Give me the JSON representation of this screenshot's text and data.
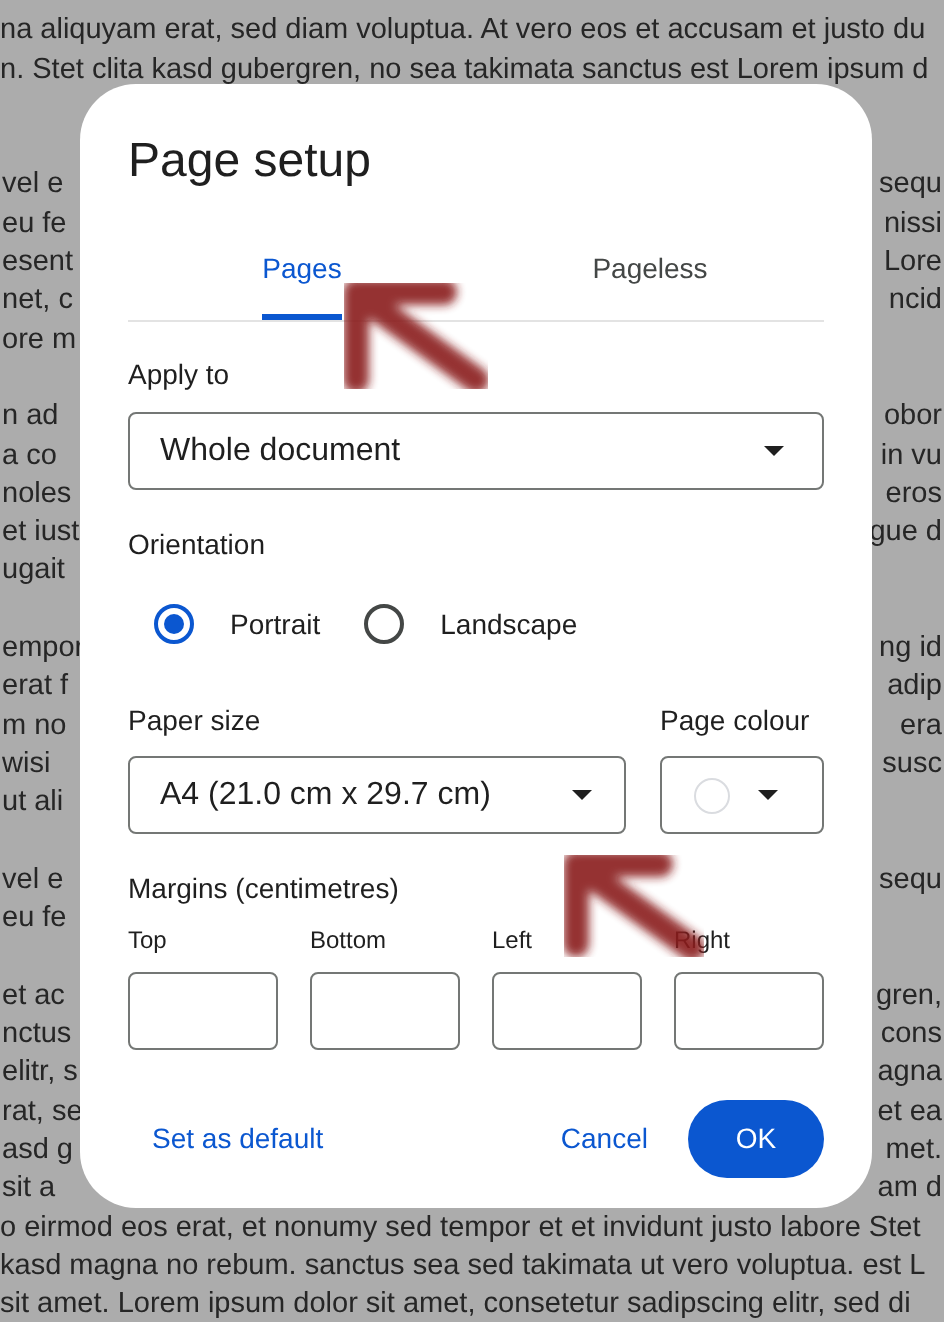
{
  "document": {
    "lines": [
      {
        "kind": "blank"
      },
      {
        "kind": "full",
        "text": "na aliquyam erat, sed diam voluptua. At vero eos et accusam et justo du"
      },
      {
        "kind": "full",
        "text": "n. Stet clita kasd gubergren, no sea takimata sanctus est Lorem ipsum d"
      },
      {
        "kind": "blank"
      },
      {
        "kind": "blank"
      },
      {
        "kind": "split",
        "left": "vel e",
        "right": "sequ"
      },
      {
        "kind": "split",
        "left": "eu fe",
        "right": "nissi"
      },
      {
        "kind": "split",
        "left": "esent",
        "right": "Lore"
      },
      {
        "kind": "split",
        "left": "net, c",
        "right": "ncid"
      },
      {
        "kind": "split",
        "left": "ore m"
      },
      {
        "kind": "blank"
      },
      {
        "kind": "split",
        "left": "n ad",
        "right": "obor"
      },
      {
        "kind": "split",
        "left": "a co",
        "right": "in vu"
      },
      {
        "kind": "split",
        "left": "noles",
        "right": "eros"
      },
      {
        "kind": "split",
        "left": "et iust",
        "right": "gue d"
      },
      {
        "kind": "split",
        "left": "ugait"
      },
      {
        "kind": "blank"
      },
      {
        "kind": "split",
        "left": "empor",
        "right": "ng id"
      },
      {
        "kind": "split",
        "left": "erat f",
        "right": "adip"
      },
      {
        "kind": "split",
        "left": "m no",
        "right": "era"
      },
      {
        "kind": "split",
        "left": "wisi",
        "right": "susc"
      },
      {
        "kind": "split",
        "left": "ut ali"
      },
      {
        "kind": "blank"
      },
      {
        "kind": "split",
        "left": "vel e",
        "right": "sequ"
      },
      {
        "kind": "split",
        "left": "eu fe"
      },
      {
        "kind": "blank"
      },
      {
        "kind": "split",
        "left": "et ac",
        "right": "gren,"
      },
      {
        "kind": "split",
        "left": "nctus",
        "right": "cons"
      },
      {
        "kind": "split",
        "left": "elitr, s",
        "right": "agna"
      },
      {
        "kind": "split",
        "left": "rat, se",
        "right": "et ea"
      },
      {
        "kind": "split",
        "left": "asd g",
        "right": "met."
      },
      {
        "kind": "split",
        "left": "sit a",
        "right": "am d"
      },
      {
        "kind": "full",
        "text": "o eirmod eos erat, et nonumy sed tempor et et invidunt justo labore Stet"
      },
      {
        "kind": "full",
        "text": "kasd magna no rebum. sanctus sea sed takimata ut vero voluptua. est L"
      },
      {
        "kind": "full",
        "text": "sit amet. Lorem ipsum dolor sit amet, consetetur sadipscing elitr, sed di"
      }
    ]
  },
  "dialog": {
    "title": "Page setup",
    "tabs": [
      {
        "label": "Pages",
        "selected": true
      },
      {
        "label": "Pageless",
        "selected": false
      }
    ],
    "apply_to": {
      "label": "Apply to",
      "value": "Whole document"
    },
    "orientation": {
      "label": "Orientation",
      "options": [
        {
          "label": "Portrait",
          "selected": true
        },
        {
          "label": "Landscape",
          "selected": false
        }
      ]
    },
    "paper_size": {
      "label": "Paper size",
      "value": "A4 (21.0 cm x 29.7 cm)"
    },
    "page_colour": {
      "label": "Page colour",
      "color": "#ffffff"
    },
    "margins": {
      "label": "Margins (centimetres)",
      "fields": [
        {
          "label": "Top"
        },
        {
          "label": "Bottom"
        },
        {
          "label": "Left"
        },
        {
          "label": "Right"
        }
      ]
    },
    "buttons": {
      "set_default": "Set as default",
      "cancel": "Cancel",
      "ok": "OK"
    }
  },
  "annotations": [
    {
      "kind": "arrow"
    },
    {
      "kind": "arrow"
    }
  ]
}
